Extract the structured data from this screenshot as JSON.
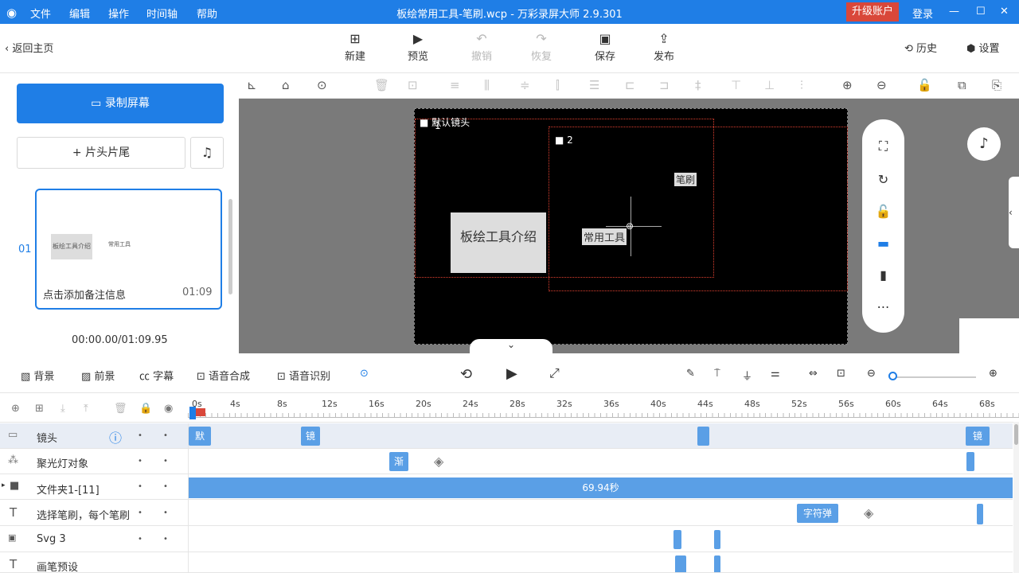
{
  "titlebar": {
    "menus": [
      "文件",
      "编辑",
      "操作",
      "时间轴",
      "帮助"
    ],
    "title": "板绘常用工具-笔刷.wcp - 万彩录屏大师 2.9.301",
    "upgrade": "升级账户",
    "login": "登录"
  },
  "toolbar": {
    "back": "返回主页",
    "new": "新建",
    "preview": "预览",
    "undo": "撤销",
    "redo": "恢复",
    "save": "保存",
    "publish": "发布",
    "history": "历史",
    "settings": "设置"
  },
  "left": {
    "record": "录制屏幕",
    "headtail": "片头片尾",
    "slide_index": "01",
    "slide_note": "点击添加备注信息",
    "slide_duration": "01:09",
    "thumb_text1": "板绘工具介绍",
    "thumb_text2": "常用工具",
    "time": "00:00.00/01:09.95"
  },
  "stage": {
    "cam_label": "默认镜头",
    "cam1": "1",
    "cam2": "2",
    "text_main": "板绘工具介绍",
    "text_brush": "笔刷",
    "text_common": "常用工具"
  },
  "controls": {
    "bg": "背景",
    "fg": "前景",
    "caption": "字幕",
    "tts": "语音合成",
    "asr": "语音识别"
  },
  "ruler": {
    "ticks": [
      "0s",
      "4s",
      "8s",
      "12s",
      "16s",
      "20s",
      "24s",
      "28s",
      "32s",
      "36s",
      "40s",
      "44s",
      "48s",
      "52s",
      "56s",
      "60s",
      "64s",
      "68s"
    ]
  },
  "tracks": [
    {
      "name": "镜头",
      "clips": [
        "默",
        "镜",
        "镜"
      ]
    },
    {
      "name": "聚光灯对象",
      "clips": [
        "渐"
      ]
    },
    {
      "name": "文件夹1-[11]",
      "clips": [
        "69.94秒"
      ]
    },
    {
      "name": "选择笔刷，每个笔刷",
      "clips": [
        "字符弹"
      ]
    },
    {
      "name": "Svg 3",
      "clips": []
    },
    {
      "name": "画笔预设",
      "clips": []
    }
  ]
}
